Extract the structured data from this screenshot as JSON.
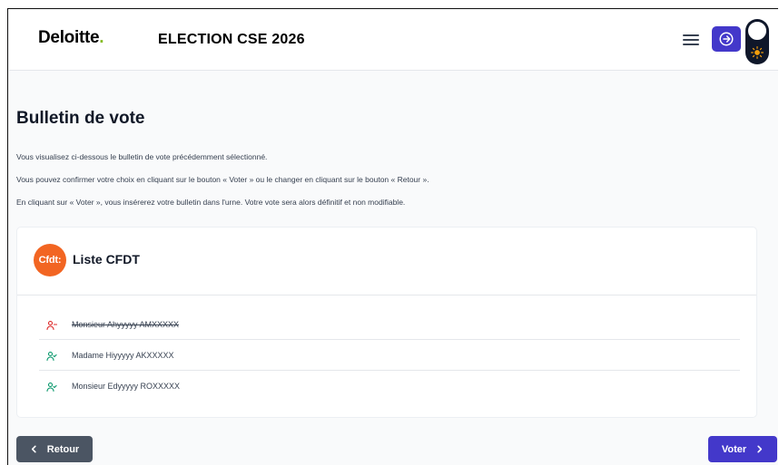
{
  "header": {
    "logo_text": "Deloitte",
    "logo_dot": ".",
    "title": "ELECTION CSE 2026",
    "menu_icon": "hamburger-menu-icon",
    "login_icon": "login-icon",
    "theme_icon": "sun-icon"
  },
  "page": {
    "title": "Bulletin de vote",
    "paragraphs": [
      "Vous visualisez ci-dessous le bulletin de vote précédemment sélectionné.",
      "Vous pouvez confirmer votre choix en cliquant sur le bouton « Voter » ou le changer en cliquant sur le bouton « Retour ».",
      "En cliquant sur « Voter », vous insérerez votre bulletin dans l'urne. Votre vote sera alors définitif et non modifiable."
    ]
  },
  "ballot": {
    "logo_text": "Cfdt:",
    "list_name": "Liste CFDT",
    "candidates": [
      {
        "name": "Monsieur Ahyyyyy AMXXXXX",
        "struck": true,
        "icon": "user-removed-icon"
      },
      {
        "name": "Madame Hiyyyyy AKXXXXX",
        "struck": false,
        "icon": "user-icon"
      },
      {
        "name": "Monsieur Edyyyyy ROXXXXX",
        "struck": false,
        "icon": "user-icon"
      }
    ]
  },
  "actions": {
    "back_label": "Retour",
    "back_icon": "chevron-left-icon",
    "vote_label": "Voter",
    "vote_icon": "chevron-right-icon"
  },
  "colors": {
    "primary": "#4338ca",
    "secondary": "#4b5563",
    "cfdt_orange": "#f26522",
    "struck_red": "#dc2626",
    "active_green": "#059669",
    "deloitte_green": "#86bc25"
  }
}
